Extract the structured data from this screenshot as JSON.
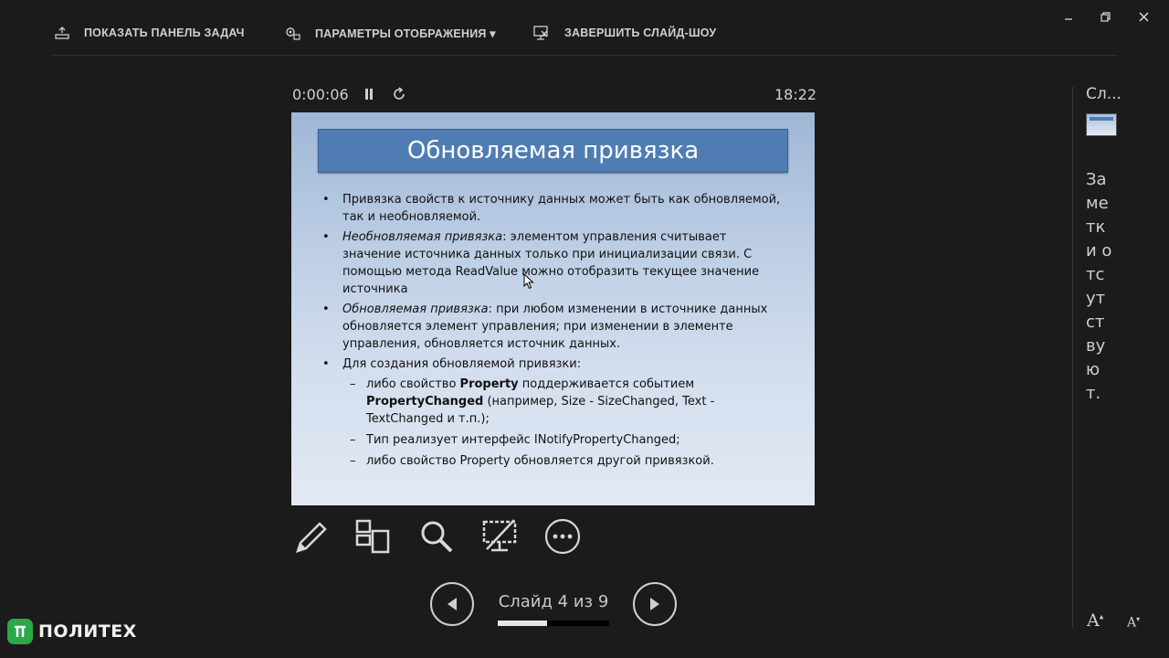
{
  "toolbar": {
    "show_taskbar": "ПОКАЗАТЬ ПАНЕЛЬ ЗАДАЧ",
    "display_settings": "ПАРАМЕТРЫ ОТОБРАЖЕНИЯ ▾",
    "end_show": "ЗАВЕРШИТЬ СЛАЙД-ШОУ"
  },
  "timer": {
    "elapsed": "0:00:06",
    "clock": "18:22"
  },
  "slide": {
    "title": "Обновляемая привязка",
    "b1": "Привязка свойств к источнику данных может быть как обновляемой, так и необновляемой.",
    "b2_italic": "Необновляемая привязка",
    "b2_text": ": элементом управления считывает значение источника данных только при инициализации связи. С помощью метода ReadValue можно отобразить текущее значение источника",
    "b3_italic": "Обновляемая привязка",
    "b3_text": ": при любом изменении в источнике данных обновляется элемент управления; при изменении в элементе управления, обновляется источник данных.",
    "b4": "Для создания обновляемой привязки:",
    "s1_a": "либо свойство ",
    "s1_bold1": "Property",
    "s1_b": " поддерживается событием ",
    "s1_bold2": "PropertyChanged",
    "s1_c": " (например, Size - SizeChanged, Text - TextChanged и т.п.);",
    "s2": "Тип реализует интерфейс INotifyPropertyChanged;",
    "s3": "либо  свойство Property обновляется другой привязкой."
  },
  "navigation": {
    "counter": "Слайд 4 из 9",
    "progress_fraction": 0.44
  },
  "side_panel": {
    "next_label": "Сл...",
    "notes": "Заметки отсутствуют."
  },
  "font_controls": {
    "increase": "A",
    "decrease": "A"
  },
  "brand": {
    "name": "ПОЛИТЕХ"
  },
  "icons": [
    "taskbar-icon",
    "display-settings-icon",
    "end-show-icon",
    "minimize-icon",
    "restore-icon",
    "close-icon",
    "pause-icon",
    "restart-icon",
    "pen-icon",
    "slides-grid-icon",
    "zoom-icon",
    "black-screen-icon",
    "more-icon",
    "prev-icon",
    "next-icon"
  ]
}
